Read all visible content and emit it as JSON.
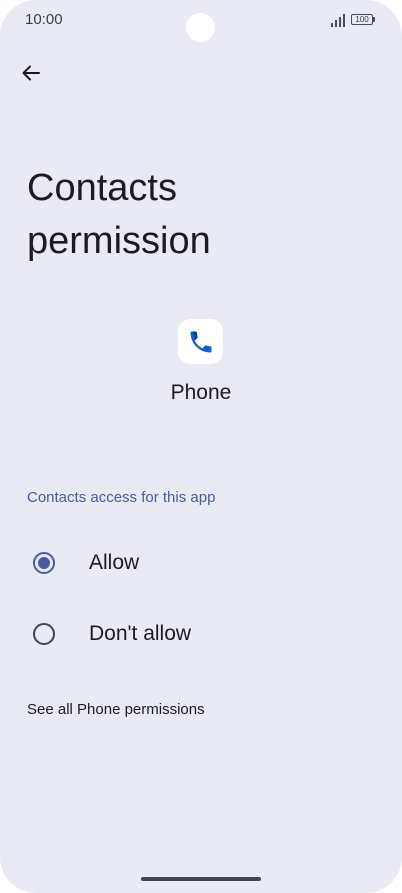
{
  "status_bar": {
    "time": "10:00",
    "battery": "100",
    "icons": [
      "signal-icon",
      "battery-icon"
    ]
  },
  "header": {
    "back_icon": "arrow-left-icon",
    "title": "Contacts permission"
  },
  "app": {
    "icon": "phone-icon",
    "name": "Phone"
  },
  "permission": {
    "section_label": "Contacts access for this app",
    "options": [
      {
        "label": "Allow",
        "selected": true
      },
      {
        "label": "Don't allow",
        "selected": false
      }
    ]
  },
  "footer_link": "See all Phone permissions",
  "colors": {
    "background": "#e9eaf3",
    "accent": "#4a5aa0",
    "text": "#1b1b21",
    "phone_icon": "#1a5dd8"
  }
}
